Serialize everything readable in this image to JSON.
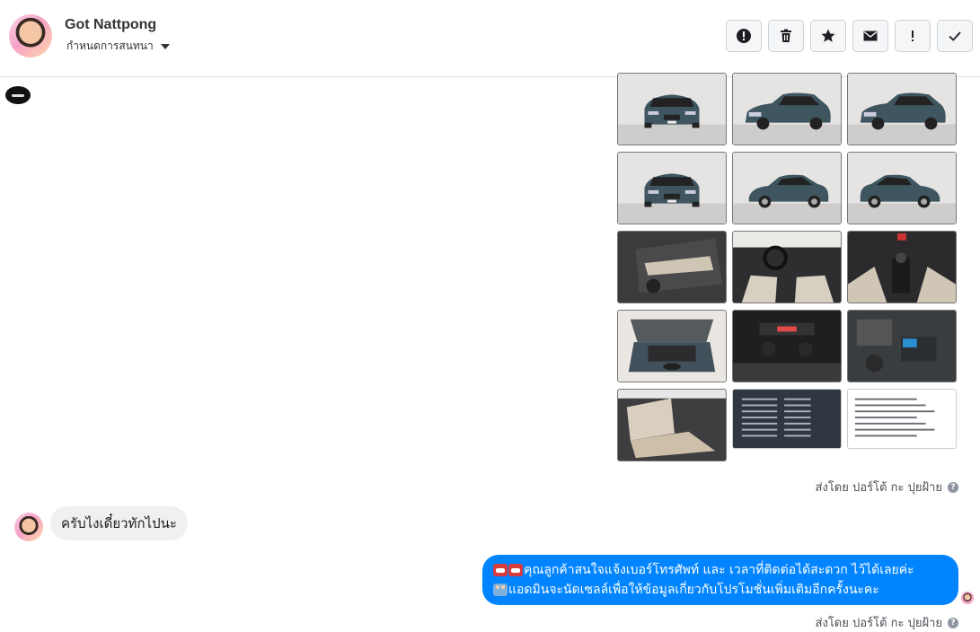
{
  "header": {
    "name": "Got Nattpong",
    "subtitle": "กำหนดการสนทนา",
    "toolbar": [
      {
        "name": "report-button",
        "icon": "exclamation-circle-icon"
      },
      {
        "name": "delete-button",
        "icon": "trash-icon"
      },
      {
        "name": "star-button",
        "icon": "star-icon"
      },
      {
        "name": "mark-unread-button",
        "icon": "envelope-icon"
      },
      {
        "name": "important-button",
        "icon": "exclamation-icon"
      },
      {
        "name": "done-button",
        "icon": "check-icon"
      }
    ]
  },
  "gallery": {
    "images": [
      {
        "name": "car-front-view",
        "kind": "car-front"
      },
      {
        "name": "car-front-three-quarter",
        "kind": "car-34"
      },
      {
        "name": "car-rear-three-quarter",
        "kind": "car-rear34"
      },
      {
        "name": "car-rear-view",
        "kind": "car-rear"
      },
      {
        "name": "car-side-view",
        "kind": "car-side"
      },
      {
        "name": "car-side-view-2",
        "kind": "car-side2"
      },
      {
        "name": "car-door-panel",
        "kind": "interior-door"
      },
      {
        "name": "car-dashboard",
        "kind": "interior-dash"
      },
      {
        "name": "car-gear-shift",
        "kind": "interior-gear"
      },
      {
        "name": "car-engine-bay",
        "kind": "engine-open"
      },
      {
        "name": "car-console",
        "kind": "console"
      },
      {
        "name": "car-engine-closeup",
        "kind": "engine"
      },
      {
        "name": "car-rear-seats",
        "kind": "seats"
      },
      {
        "name": "spec-screenshot-dark",
        "kind": "doc-dark"
      },
      {
        "name": "spec-screenshot-light",
        "kind": "doc-light"
      }
    ]
  },
  "sent_by_1": "ส่งโดย ปอร์โต้ กะ ปุยฝ้าย",
  "incoming_message": "ครับไงเดี๋ยวทักไปนะ",
  "outgoing_message": {
    "line1": "คุณลูกค้าสนใจแจ้งเบอร์โทรศัพท์ และ เวลาที่ติดต่อได้สะดวก ไว้ได้เลยค่ะ",
    "line2": "แอดมินจะนัดเซลล์เพื่อให้ข้อมูลเกี่ยวกับโปรโมชั่นเพิ่มเติมอีกครั้งนะคะ"
  },
  "sent_by_2": "ส่งโดย ปอร์โต้ กะ ปุยฝ้าย",
  "colors": {
    "outgoing_bubble": "#0084ff",
    "incoming_bubble": "#f1f0f0",
    "car_body": "#3f5560"
  }
}
